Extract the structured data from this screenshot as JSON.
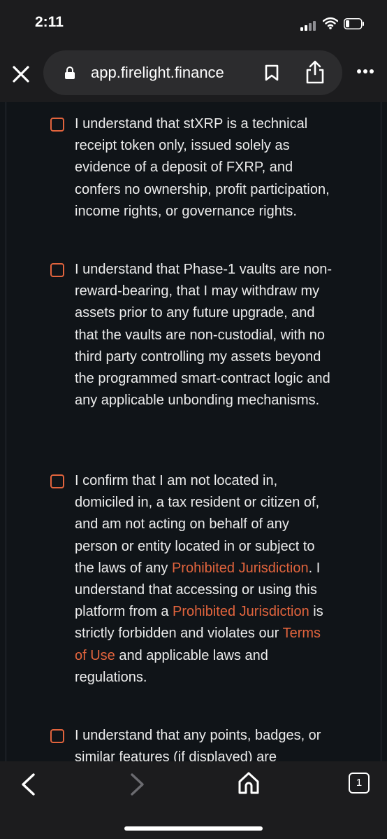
{
  "status": {
    "time": "2:11"
  },
  "browser": {
    "url": "app.firelight.finance",
    "tab_count": "1"
  },
  "items": [
    {
      "parts": [
        {
          "text": "I understand that stXRP is a technical receipt token only, issued solely as evidence of a deposit of FXRP, and confers no ownership, profit participation, income rights, or governance rights.",
          "link": false
        }
      ]
    },
    {
      "parts": [
        {
          "text": "I understand that Phase-1 vaults are non-reward-bearing, that I may withdraw my assets prior to any future upgrade, and that the vaults are non-custodial, with no third party controlling my assets beyond the programmed smart-contract logic and any applicable unbonding mechanisms.",
          "link": false
        }
      ]
    },
    {
      "parts": [
        {
          "text": "I confirm that I am not located in, domiciled in, a tax resident or citizen of, and am not acting on behalf of any person or entity located in or subject to the laws of any ",
          "link": false
        },
        {
          "text": "Prohibited Jurisdiction",
          "link": true
        },
        {
          "text": ". I understand that accessing or using this platform from a ",
          "link": false
        },
        {
          "text": "Prohibited Jurisdiction",
          "link": true
        },
        {
          "text": " is strictly forbidden and violates our ",
          "link": false
        },
        {
          "text": "Terms of Use",
          "link": true
        },
        {
          "text": " and applicable laws and regulations.",
          "link": false
        }
      ]
    },
    {
      "parts": [
        {
          "text": "I understand that any points, badges, or similar features (if displayed) are",
          "link": false
        }
      ]
    }
  ],
  "colors": {
    "accent": "#e2643d",
    "background": "#101418",
    "chrome": "#1c1c1e"
  }
}
